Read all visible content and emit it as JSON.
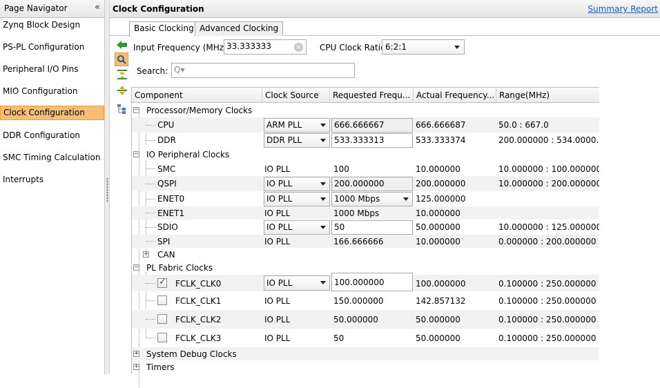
{
  "navigator": {
    "title": "Page Navigator",
    "collapse_glyph": "«",
    "items": [
      {
        "label": "Zynq Block Design",
        "selected": false
      },
      {
        "label": "PS-PL Configuration",
        "selected": false
      },
      {
        "label": "Peripheral I/O Pins",
        "selected": false
      },
      {
        "label": "MIO Configuration",
        "selected": false
      },
      {
        "label": "Clock Configuration",
        "selected": true
      },
      {
        "label": "DDR Configuration",
        "selected": false
      },
      {
        "label": "SMC Timing Calculation",
        "selected": false
      },
      {
        "label": "Interrupts",
        "selected": false
      }
    ]
  },
  "main": {
    "title": "Clock Configuration",
    "summary_link": "Summary Report",
    "tabs": [
      {
        "label": "Basic Clocking",
        "active": true
      },
      {
        "label": "Advanced Clocking",
        "active": false
      }
    ],
    "toolbar_icons": [
      "back-arrow-icon",
      "search-icon",
      "collapse-all-icon",
      "expand-all-icon",
      "hierarchy-icon"
    ],
    "input_frequency": {
      "label": "Input Frequency (MHz)",
      "value": "33.333333"
    },
    "cpu_clock_ratio": {
      "label": "CPU Clock Ratio",
      "value": "6:2:1"
    },
    "search": {
      "label": "Search:",
      "placeholder": "Q▾"
    }
  },
  "table": {
    "columns": [
      "Component",
      "Clock Source",
      "Requested Frequ...",
      "Actual Frequency...",
      "Range(MHz)"
    ],
    "groups": {
      "processor": "Processor/Memory Clocks",
      "io": "IO Peripheral Clocks",
      "pl": "PL Fabric Clocks",
      "debug": "System Debug Clocks",
      "timers": "Timers"
    },
    "rows": {
      "cpu": {
        "name": "CPU",
        "source": "ARM PLL",
        "requested": "666.666667",
        "actual": "666.666687",
        "range": "50.0 : 667.0"
      },
      "ddr": {
        "name": "DDR",
        "source": "DDR PLL",
        "requested": "533.333313",
        "actual": "533.333374",
        "range": "200.000000 : 534.0000..."
      },
      "smc": {
        "name": "SMC",
        "source": "IO PLL",
        "requested": "100",
        "actual": "10.000000",
        "range": "10.000000 : 100.000000"
      },
      "qspi": {
        "name": "QSPI",
        "source": "IO PLL",
        "requested": "200.000000",
        "actual": "200.000000",
        "range": "10.000000 : 200.000000"
      },
      "enet0": {
        "name": "ENET0",
        "source": "IO PLL",
        "requested": "1000 Mbps",
        "actual": "125.000000",
        "range": ""
      },
      "enet1": {
        "name": "ENET1",
        "source": "IO PLL",
        "requested": "1000 Mbps",
        "actual": "10.000000",
        "range": ""
      },
      "sdio": {
        "name": "SDIO",
        "source": "IO PLL",
        "requested": "50",
        "actual": "50.000000",
        "range": "10.000000 : 125.000000"
      },
      "spi": {
        "name": "SPI",
        "source": "IO PLL",
        "requested": "166.666666",
        "actual": "10.000000",
        "range": "0.000000 : 200.000000"
      },
      "can": {
        "name": "CAN"
      },
      "fclk0": {
        "name": "FCLK_CLK0",
        "checked": true,
        "source": "IO PLL",
        "requested": "100.000000",
        "actual": "100.000000",
        "range": "0.100000 : 250.000000"
      },
      "fclk1": {
        "name": "FCLK_CLK1",
        "checked": false,
        "source": "IO PLL",
        "requested": "150.000000",
        "actual": "142.857132",
        "range": "0.100000 : 250.000000"
      },
      "fclk2": {
        "name": "FCLK_CLK2",
        "checked": false,
        "source": "IO PLL",
        "requested": "50.000000",
        "actual": "50.000000",
        "range": "0.100000 : 250.000000"
      },
      "fclk3": {
        "name": "FCLK_CLK3",
        "checked": false,
        "source": "IO PLL",
        "requested": "50",
        "actual": "50.000000",
        "range": "0.100000 : 250.000000"
      }
    }
  }
}
